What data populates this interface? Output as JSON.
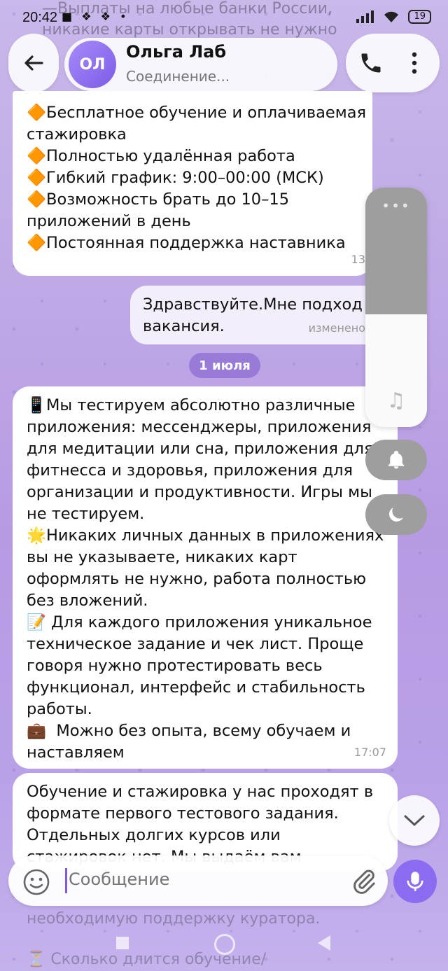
{
  "status_bar": {
    "time": "20:42",
    "left_icons": "■ ❖ ❖ •",
    "battery": "19"
  },
  "background_ghost_text": {
    "line1": "—Выплаты на любые банки России,",
    "line2": "никакие карты открывать не нужно",
    "bottom_line1": "необходимую поддержку куратора.",
    "bottom_line2": "⏳ Сколько длится обучение/"
  },
  "header": {
    "avatar_initials": "ОЛ",
    "contact_name": "Ольга Лаб",
    "contact_status": "Соединение..."
  },
  "messages": {
    "msg1": {
      "text": "🔶Бесплатное обучение и оплачиваемая стажировка\n🔶Полностью удалённая работа\n🔶Гибкий график: 9:00–00:00 (МСК)\n🔶Возможность брать до 10–15 приложений в день\n🔶Постоянная поддержка наставника",
      "time": "13"
    },
    "msg2": {
      "text": "Здравствуйте.Мне подход\nвакансия.",
      "edited": "изменено"
    },
    "date_separator": "1 июля",
    "msg3": {
      "text": "📱Мы тестируем абсолютно различные приложения: мессенджеры, приложения для медитации или сна, приложения для фитнесса и здоровья, приложения для организации и продуктивности. Игры мы не тестируем.\n🌟Никаких личных данных в приложениях вы не указываете, никаких карт оформлять не нужно, работа полностью без вложений.\n📝 Для каждого приложения уникальное техническое задание и чек лист. Проще говоря нужно протестировать весь функционал, интерфейс и стабильность работы.\n💼  Можно без опыта, всему обучаем и наставляем",
      "time": "17:07"
    },
    "msg4": {
      "text": "Обучение и стажировка у нас проходят в формате первого тестового задания. Отдельных долгих курсов или стажировок нет. Мы выдаём вам"
    }
  },
  "volume_panel": {
    "level": 0.53,
    "dots": "•••"
  },
  "composer": {
    "placeholder": "Сообщение"
  },
  "colors": {
    "accent": "#8b6cf0",
    "bubble_in": "#ffffff",
    "bubble_out": "#f3eefc",
    "volume_gray": "#9e9e9e"
  }
}
